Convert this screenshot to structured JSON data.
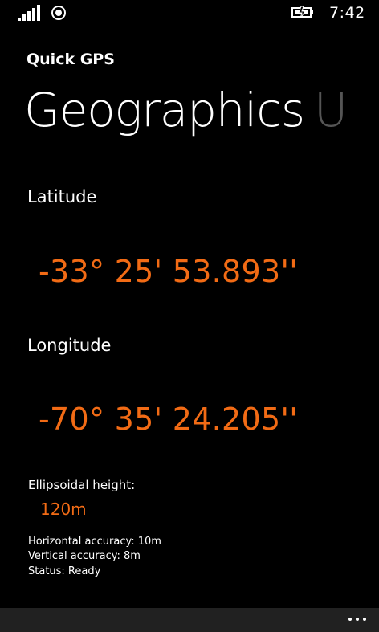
{
  "status_bar": {
    "time": "7:42",
    "icons": [
      "signal-strength-icon",
      "location-icon",
      "battery-charging-icon"
    ]
  },
  "header": {
    "app_title": "Quick GPS",
    "pivot": [
      {
        "label": "Geographics",
        "active": true
      },
      {
        "label": "U",
        "active": false
      }
    ]
  },
  "coordinates": {
    "latitude_label": "Latitude",
    "latitude_value": "-33° 25' 53.893''",
    "longitude_label": "Longitude",
    "longitude_value": "-70° 35' 24.205''",
    "height_label": "Ellipsoidal height:",
    "height_value": "120m"
  },
  "info": {
    "horizontal_accuracy": "Horizontal accuracy: 10m",
    "vertical_accuracy": "Vertical accuracy: 8m",
    "status": "Status: Ready"
  },
  "app_bar": {
    "more_icon": "ellipsis-icon"
  },
  "colors": {
    "accent": "#f26b15",
    "background": "#000000",
    "app_bar": "#212121"
  }
}
